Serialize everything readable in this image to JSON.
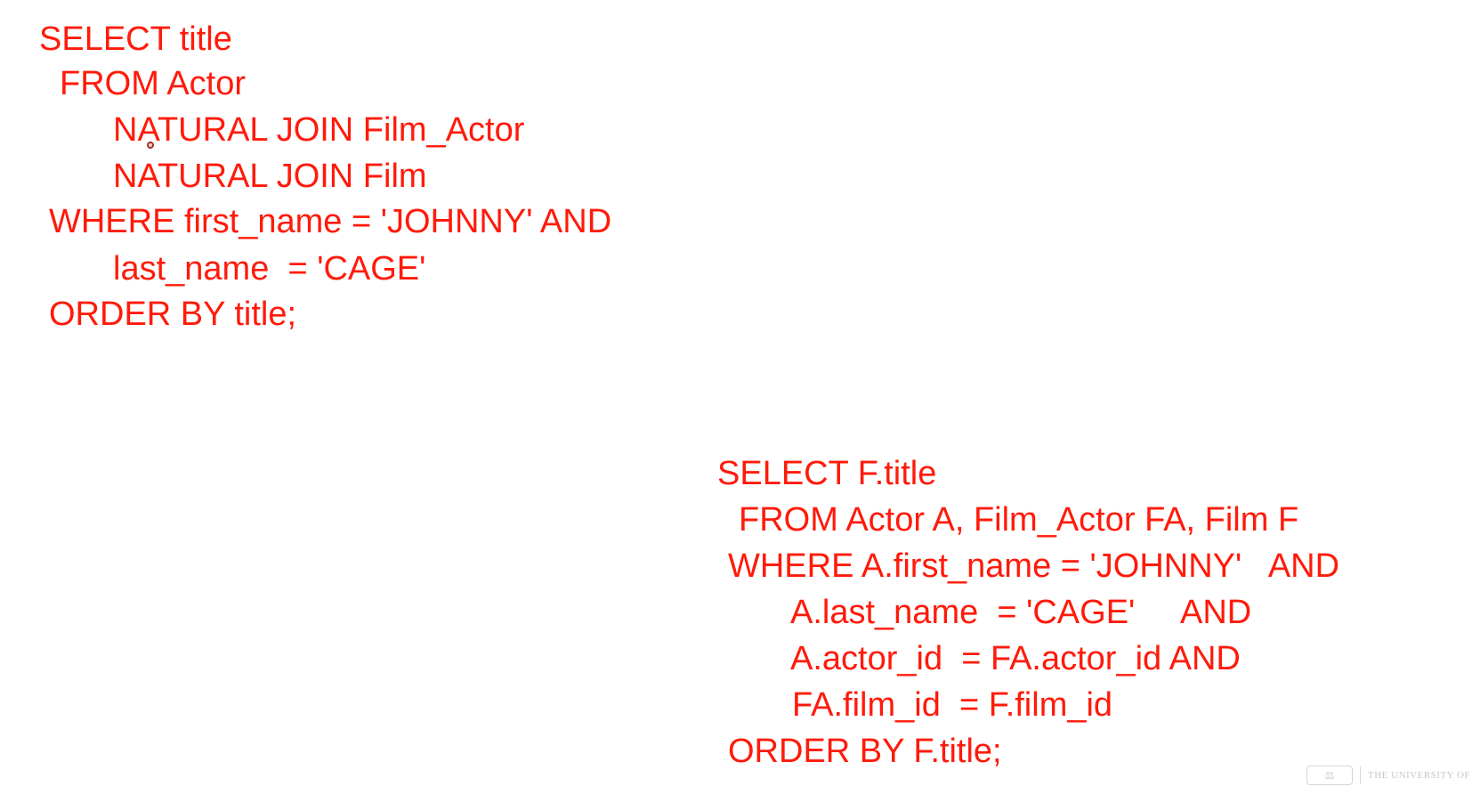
{
  "slide": {
    "text_color": "#ff1a0a",
    "background": "#ffffff"
  },
  "natural_join_query": {
    "lines": [
      "SELECT title",
      "FROM Actor",
      "NATURAL JOIN Film_Actor",
      "NATURAL JOIN Film",
      "WHERE first_name = 'JOHNNY' AND",
      "last_name  = 'CAGE'",
      "ORDER BY title;"
    ]
  },
  "explicit_join_query": {
    "lines": [
      "SELECT F.title",
      "FROM Actor A, Film_Actor FA, Film F",
      "WHERE A.first_name = 'JOHNNY'   AND",
      "A.last_name  = 'CAGE'     AND",
      "A.actor_id  = FA.actor_id AND",
      "FA.film_id  = F.film_id",
      "ORDER BY F.title;"
    ]
  },
  "watermark": {
    "logo_icon": "university-seal-icon",
    "text": "THE UNIVERSITY OF"
  }
}
